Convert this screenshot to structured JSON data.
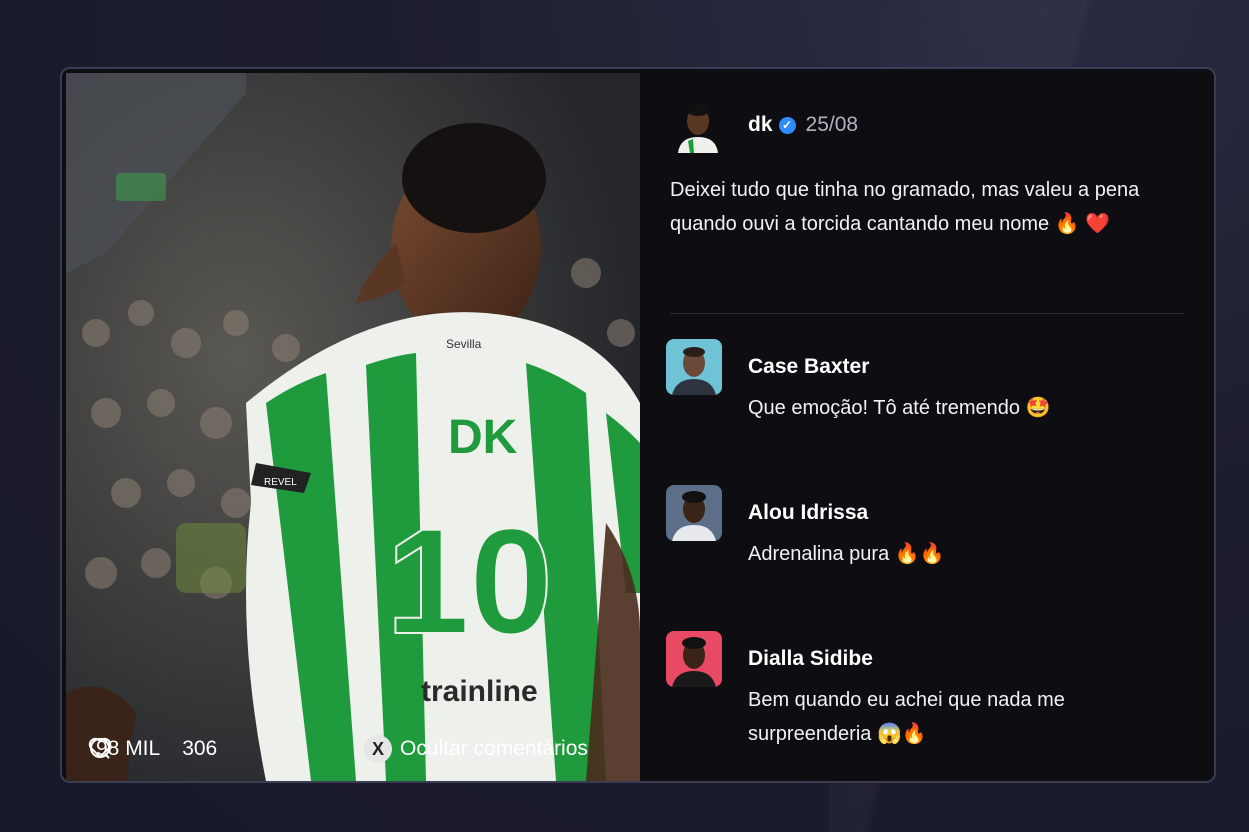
{
  "post": {
    "image_alt": "Jogador DK com a camisa 10 comemorando",
    "jersey_name": "DK",
    "jersey_number": "10",
    "sponsor": "trainline",
    "sleeve_brand": "REVEL",
    "club_text": "Sevilla",
    "likes": "98 MIL",
    "comments_count": "306",
    "hide_comments_label": "Ocultar comentários",
    "hide_button_glyph": "X",
    "author": "dk",
    "date": "25/08",
    "text": "Deixei tudo que tinha no gramado, mas valeu a pena quando ouvi a torcida cantando meu nome 🔥 ❤️"
  },
  "comments": [
    {
      "name": "Case Baxter",
      "text": "Que emoção! Tô até tremendo 🤩",
      "avatar_color": "#6fc3d6"
    },
    {
      "name": "Alou Idrissa",
      "text": "Adrenalina pura 🔥🔥",
      "avatar_color": "#5d6e88"
    },
    {
      "name": "Dialla Sidibe",
      "text": "Bem quando eu achei que nada me surpreenderia 😱🔥",
      "avatar_color": "#e84a63"
    }
  ],
  "colors": {
    "verified": "#2f8cff",
    "jersey_green": "#1f9a3d",
    "card_bg": "#0d0d12"
  },
  "icons": [
    "heart-icon",
    "comment-icon",
    "verified-icon",
    "x-button-icon"
  ]
}
